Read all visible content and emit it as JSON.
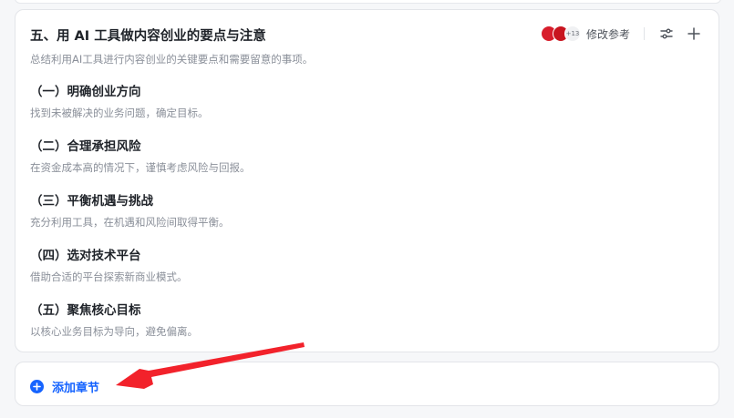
{
  "card": {
    "title": "五、用 AI 工具做内容创业的要点与注意",
    "description": "总结利用AI工具进行内容创业的关键要点和需要留意的事项。",
    "reference_label": "修改参考",
    "avatar_more": "+13",
    "sections": [
      {
        "heading": "（一）明确创业方向",
        "desc": "找到未被解决的业务问题，确定目标。"
      },
      {
        "heading": "（二）合理承担风险",
        "desc": "在资金成本高的情况下，谨慎考虑风险与回报。"
      },
      {
        "heading": "（三）平衡机遇与挑战",
        "desc": "充分利用工具，在机遇和风险间取得平衡。"
      },
      {
        "heading": "（四）选对技术平台",
        "desc": "借助合适的平台探索新商业模式。"
      },
      {
        "heading": "（五）聚焦核心目标",
        "desc": "以核心业务目标为导向，避免偏离。"
      }
    ],
    "icons": {
      "settings": "sliders-icon",
      "add": "plus-icon"
    }
  },
  "add_section": {
    "label": "添加章节",
    "icon": "plus-circle-icon"
  },
  "colors": {
    "accent": "#1664ff",
    "annotation_arrow": "#f2222b",
    "title": "#1f2329",
    "muted": "#8a8f99"
  }
}
